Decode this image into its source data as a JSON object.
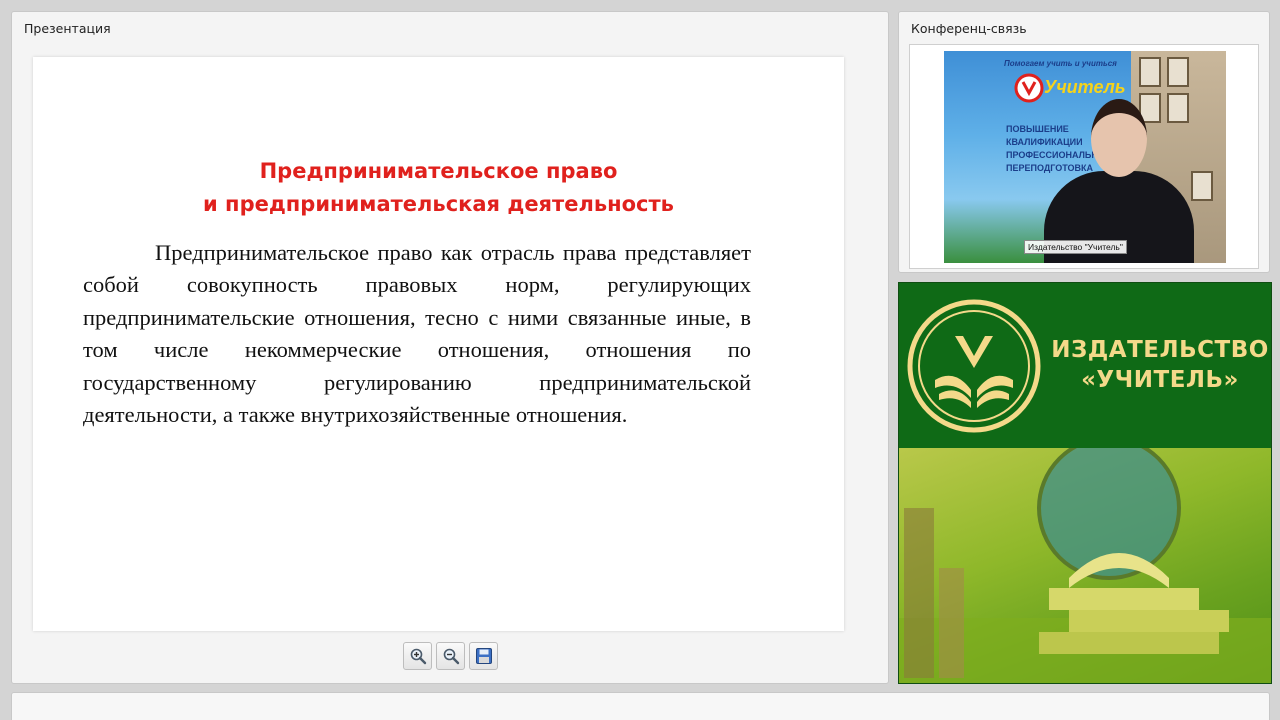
{
  "presentation": {
    "title": "Презентация",
    "slide": {
      "title_line1": "Предпринимательское право",
      "title_line2": "и предпринимательская деятельность",
      "body": "Предпринимательское право как отрасль права представляет собой совокупность правовых норм, регулирующих предпринимательские отношения, тесно с ними связанные иные, в том числе некоммерческие отношения, отношения по государственному регулированию предпринимательской деятельности, а также внутрихозяйственные отношения."
    },
    "toolbar": {
      "zoom_in_icon": "zoom-in-icon",
      "zoom_out_icon": "zoom-out-icon",
      "save_icon": "save-icon"
    }
  },
  "conference": {
    "title": "Конференц-связь",
    "participant_label": "Издательство \"Учитель\"",
    "banner_tagline": "Помогаем учить и учиться",
    "banner_logo": "Учитель",
    "banner_bullets": [
      "ПОВЫШЕНИЕ",
      "КВАЛИФИКАЦИИ",
      "ПРОФЕССИОНАЛЬНАЯ",
      "ПЕРЕПОДГОТОВКА"
    ]
  },
  "publisher": {
    "name_line1": "ИЗДАТЕЛЬСТВО",
    "name_line2": "«УЧИТЕЛЬ»"
  },
  "colors": {
    "slide_title": "#e0211d",
    "brand_green": "#0f6a16",
    "brand_gold": "#f4d98a"
  }
}
